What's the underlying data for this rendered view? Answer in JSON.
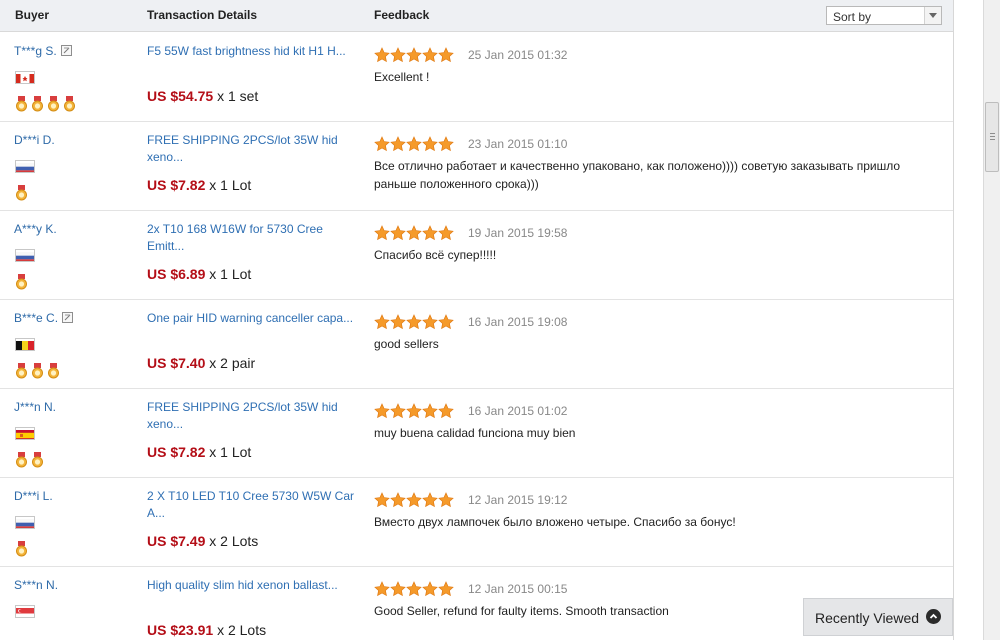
{
  "header": {
    "buyer": "Buyer",
    "transaction": "Transaction Details",
    "feedback": "Feedback",
    "sort_label": "Sort by"
  },
  "rows": [
    {
      "buyer": "T***g S.",
      "edit_icon": true,
      "flag": "canada",
      "medals": 4,
      "title": "F5 55W fast brightness hid kit H1 H...",
      "price": "US $54.75",
      "qty": "x 1 set",
      "stars": 5,
      "date": "25 Jan 2015 01:32",
      "comment": "Excellent !"
    },
    {
      "buyer": "D***i D.",
      "edit_icon": false,
      "flag": "russia",
      "medals": 1,
      "title": "FREE SHIPPING 2PCS/lot 35W hid xeno...",
      "price": "US $7.82",
      "qty": "x 1 Lot",
      "stars": 5,
      "date": "23 Jan 2015 01:10",
      "comment": "Все отлично работает и качественно упаковано, как положено)))) советую заказывать пришло раньше положенного срока)))"
    },
    {
      "buyer": "A***y K.",
      "edit_icon": false,
      "flag": "russia",
      "medals": 1,
      "title": "2x T10 168 W16W for 5730 Cree Emitt...",
      "price": "US $6.89",
      "qty": "x 1 Lot",
      "stars": 5,
      "date": "19 Jan 2015 19:58",
      "comment": "Спасибо всё супер!!!!!"
    },
    {
      "buyer": "B***e C.",
      "edit_icon": true,
      "flag": "belgium",
      "medals": 3,
      "title": "One pair HID warning canceller capa...",
      "price": "US $7.40",
      "qty": "x 2 pair",
      "stars": 5,
      "date": "16 Jan 2015 19:08",
      "comment": "good sellers"
    },
    {
      "buyer": "J***n N.",
      "edit_icon": false,
      "flag": "spain",
      "medals": 2,
      "title": "FREE SHIPPING 2PCS/lot 35W hid xeno...",
      "price": "US $7.82",
      "qty": "x 1 Lot",
      "stars": 5,
      "date": "16 Jan 2015 01:02",
      "comment": "muy buena calidad funciona muy bien"
    },
    {
      "buyer": "D***i L.",
      "edit_icon": false,
      "flag": "russia",
      "medals": 1,
      "title": "2 X T10 LED T10 Cree 5730 W5W Car A...",
      "price": "US $7.49",
      "qty": "x 2 Lots",
      "stars": 5,
      "date": "12 Jan 2015 19:12",
      "comment": "Вместо двух лампочек было вложено четыре. Спасибо за бонус!"
    },
    {
      "buyer": "S***n N.",
      "edit_icon": false,
      "flag": "singapore",
      "medals": 0,
      "title": "High quality slim hid xenon ballast...",
      "price": "US $23.91",
      "qty": "x 2 Lots",
      "stars": 5,
      "date": "12 Jan 2015 00:15",
      "comment": "Good Seller, refund for faulty items. Smooth transaction"
    }
  ],
  "recently_viewed": "Recently Viewed",
  "colors": {
    "link": "#2f6fb3",
    "price": "#b40e17",
    "star": "#f59a2a",
    "header_bg": "#eef0f3"
  }
}
